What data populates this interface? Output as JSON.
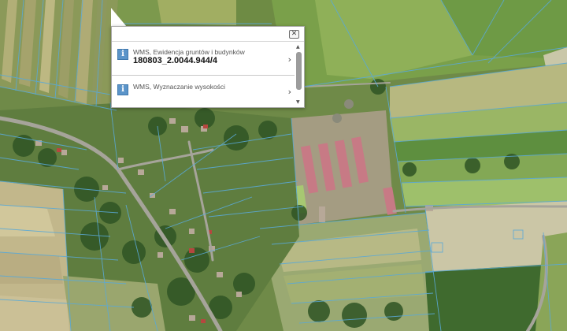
{
  "map": {
    "layer": "orthophoto",
    "overlay_color": "#5aa9d6"
  },
  "popup": {
    "close_glyph": "✕",
    "rows": [
      {
        "icon": "info-icon",
        "title": "WMS, Ewidencja gruntów i budynków",
        "value": "180803_2.0044.944/4"
      },
      {
        "icon": "info-icon",
        "title": "WMS, Wyznaczanie wysokości"
      }
    ],
    "chevron": "›"
  }
}
